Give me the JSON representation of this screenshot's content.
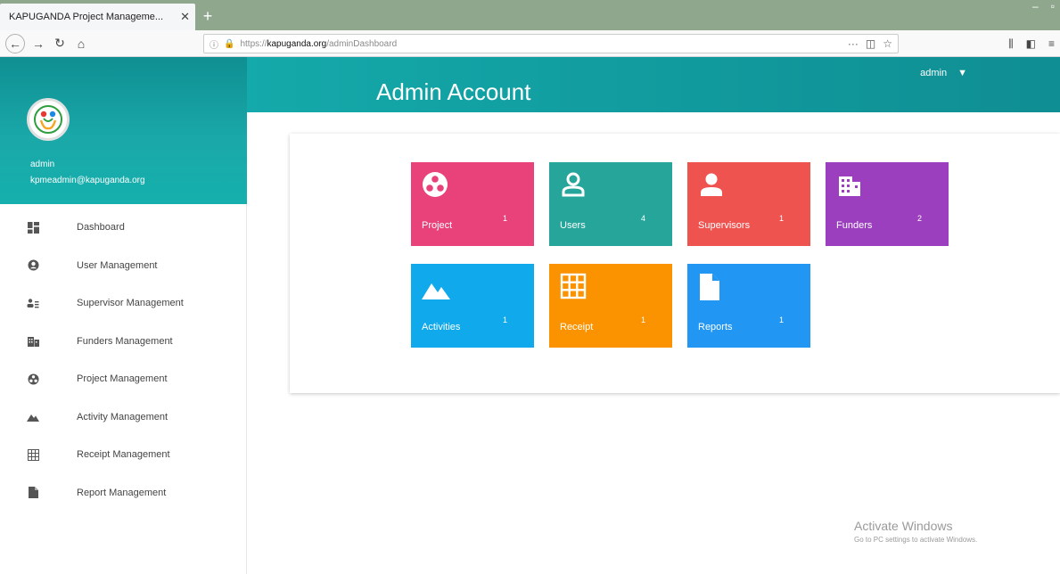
{
  "browser": {
    "tab_title": "KAPUGANDA Project Manageme...",
    "url_prefix": "https://",
    "url_domain": "kapuganda.org",
    "url_path": "/adminDashboard"
  },
  "header": {
    "title": "Admin Account",
    "user": "admin"
  },
  "sidebar": {
    "username": "admin",
    "email": "kpmeadmin@kapuganda.org",
    "items": [
      {
        "label": "Dashboard",
        "icon": "dashboard-icon"
      },
      {
        "label": "User Management",
        "icon": "user-circle-icon"
      },
      {
        "label": "Supervisor Management",
        "icon": "supervisors-icon"
      },
      {
        "label": "Funders Management",
        "icon": "building-icon"
      },
      {
        "label": "Project Management",
        "icon": "project-icon"
      },
      {
        "label": "Activity Management",
        "icon": "mountain-icon"
      },
      {
        "label": "Receipt Management",
        "icon": "grid-icon"
      },
      {
        "label": "Report Management",
        "icon": "document-icon"
      }
    ]
  },
  "tiles": [
    {
      "label": "Project",
      "count": "1",
      "color": "#e9417a",
      "icon": "project-icon"
    },
    {
      "label": "Users",
      "count": "4",
      "color": "#26a69a",
      "icon": "user-icon"
    },
    {
      "label": "Supervisors",
      "count": "1",
      "color": "#ef5350",
      "icon": "person-icon"
    },
    {
      "label": "Funders",
      "count": "2",
      "color": "#9c3fbf",
      "icon": "building-icon"
    },
    {
      "label": "Activities",
      "count": "1",
      "color": "#0fa9ec",
      "icon": "mountain-icon"
    },
    {
      "label": "Receipt",
      "count": "1",
      "color": "#fb9300",
      "icon": "grid-icon"
    },
    {
      "label": "Reports",
      "count": "1",
      "color": "#2196f3",
      "icon": "document-icon"
    }
  ],
  "watermark": {
    "title": "Activate Windows",
    "subtitle": "Go to PC settings to activate Windows."
  }
}
